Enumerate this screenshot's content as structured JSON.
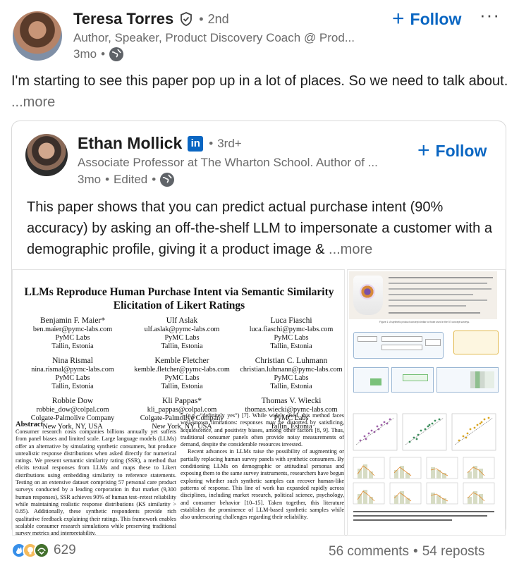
{
  "post": {
    "author": {
      "name": "Teresa Torres",
      "degree": "2nd",
      "headline": "Author, Speaker, Product Discovery Coach @ Prod...",
      "time": "3mo"
    },
    "follow_label": "Follow",
    "more_menu": "···",
    "text": "I'm starting to see this paper pop up in a lot of places. So we need to talk about.",
    "see_more": "...more"
  },
  "shared": {
    "author": {
      "name": "Ethan Mollick",
      "degree": "3rd+",
      "headline": "Associate Professor at The Wharton School. Author of ...",
      "time": "3mo",
      "edited": "Edited"
    },
    "follow_label": "Follow",
    "text": "This paper shows that you can predict actual purchase intent (90% accuracy) by asking an off-the-shelf LLM to impersonate a customer with a demographic profile, giving it a product image &",
    "see_more": "...more"
  },
  "paper": {
    "title_line1": "LLMs Reproduce Human Purchase Intent via Semantic Similarity",
    "title_line2": "Elicitation of Likert Ratings",
    "authors": [
      {
        "name": "Benjamin F. Maier*",
        "email": "ben.maier@pymc-labs.com",
        "org": "PyMC Labs",
        "loc": "Tallin, Estonia"
      },
      {
        "name": "Ulf Aslak",
        "email": "ulf.aslak@pymc-labs.com",
        "org": "PyMC Labs",
        "loc": "Tallin, Estonia"
      },
      {
        "name": "Luca Fiaschi",
        "email": "luca.fiaschi@pymc-labs.com",
        "org": "PyMC Labs",
        "loc": "Tallin, Estonia"
      },
      {
        "name": "Nina Rismal",
        "email": "nina.rismal@pymc-labs.com",
        "org": "PyMC Labs",
        "loc": "Tallin, Estonia"
      },
      {
        "name": "Kemble Fletcher",
        "email": "kemble.fletcher@pymc-labs.com",
        "org": "PyMC Labs",
        "loc": "Tallin, Estonia"
      },
      {
        "name": "Christian C. Luhmann",
        "email": "christian.luhmann@pymc-labs.com",
        "org": "PyMC Labs",
        "loc": "Tallin, Estonia"
      },
      {
        "name": "Robbie Dow",
        "email": "robbie_dow@colpal.com",
        "org": "Colgate-Palmolive Company",
        "loc": "New York, NY, USA"
      },
      {
        "name": "Kli Pappas*",
        "email": "kli_pappas@colpal.com",
        "org": "Colgate-Palmolive Company",
        "loc": "New York, NY, USA"
      },
      {
        "name": "Thomas V. Wiecki",
        "email": "thomas.wiecki@pymc-labs.com",
        "org": "PyMC Labs",
        "loc": "Tallin, Estonia"
      }
    ],
    "abstract_heading": "Abstract",
    "abstract_text": "Consumer research costs companies billions annually yet suffers from panel biases and limited scale. Large language models (LLMs) offer an alternative by simulating synthetic consumers, but produce unrealistic response distributions when asked directly for numerical ratings. We present semantic similarity rating (SSR), a method that elicits textual responses from LLMs and maps these to Likert distributions using embedding similarity to reference statements. Testing on an extensive dataset comprising 57 personal care product surveys conducted by a leading corporation in that market (9,300 human responses), SSR achieves 90% of human test–retest reliability while maintaining realistic response distributions (KS similarity > 0.85). Additionally, these synthetic respondents provide rich qualitative feedback explaining their ratings. This framework enables scalable consumer research simulations while preserving traditional survey metrics and interpretability.",
    "col2_text": "5 (e.g., “definitely yes”) [7]. While widely used, this method faces well-known limitations: responses may be distorted by satisficing, acquiescence, and positivity biases, among other factors [8, 9]. Thus, traditional consumer panels often provide noisy measurements of demand, despite the considerable resources invested.",
    "col2_text_b": "Recent advances in LLMs raise the possibility of augmenting or partially replacing human survey panels with synthetic consumers. By conditioning LLMs on demographic or attitudinal personas and exposing them to the same survey instruments, researchers have begun exploring whether such synthetic samples can recover human-like patterns of response. This line of work has expanded rapidly across disciplines, including market research, political science, psychology, and consumer behavior [10–15]. Taken together, this literature establishes the prominence of LLM-based synthetic samples while also underscoring challenges regarding their reliability.",
    "fig_caption": "Figure 1: A synthetic product concept similar to those used in the 57 concept surveys."
  },
  "footer": {
    "reactions_count": "629",
    "comments": "56 comments",
    "reposts": "54 reposts"
  },
  "colors": {
    "accent": "#0a66c2",
    "muted": "#6b6b6b"
  }
}
